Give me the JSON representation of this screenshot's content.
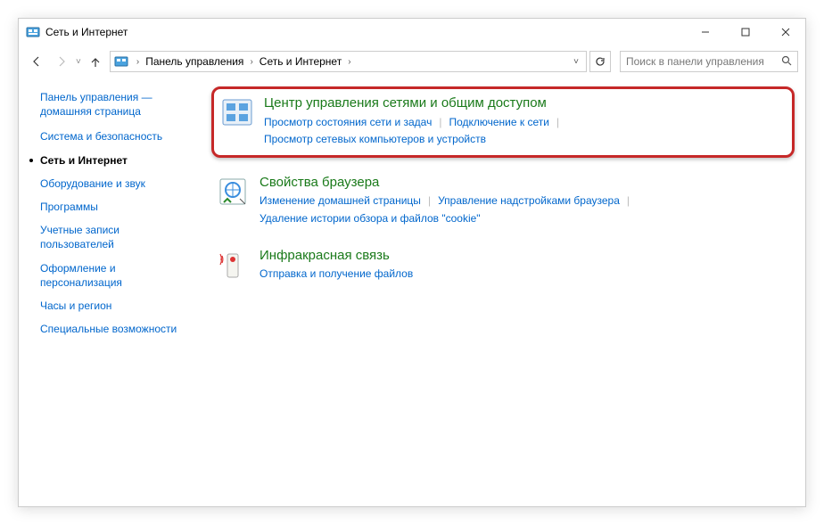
{
  "window": {
    "title": "Сеть и Интернет"
  },
  "address": {
    "seg1": "Панель управления",
    "seg2": "Сеть и Интернет"
  },
  "search": {
    "placeholder": "Поиск в панели управления"
  },
  "sidebar": {
    "title": "Панель управления — домашняя страница",
    "items": [
      {
        "label": "Система и безопасность",
        "active": false
      },
      {
        "label": "Сеть и Интернет",
        "active": true
      },
      {
        "label": "Оборудование и звук",
        "active": false
      },
      {
        "label": "Программы",
        "active": false
      },
      {
        "label": "Учетные записи пользователей",
        "active": false
      },
      {
        "label": "Оформление и персонализация",
        "active": false
      },
      {
        "label": "Часы и регион",
        "active": false
      },
      {
        "label": "Специальные возможности",
        "active": false
      }
    ]
  },
  "categories": [
    {
      "title": "Центр управления сетями и общим доступом",
      "links": [
        "Просмотр состояния сети и задач",
        "Подключение к сети",
        "Просмотр сетевых компьютеров и устройств"
      ],
      "highlight": true,
      "icon": "network"
    },
    {
      "title": "Свойства браузера",
      "links": [
        "Изменение домашней страницы",
        "Управление надстройками браузера",
        "Удаление истории обзора и файлов \"cookie\""
      ],
      "highlight": false,
      "icon": "browser"
    },
    {
      "title": "Инфракрасная связь",
      "links": [
        "Отправка и получение файлов"
      ],
      "highlight": false,
      "icon": "infrared"
    }
  ]
}
